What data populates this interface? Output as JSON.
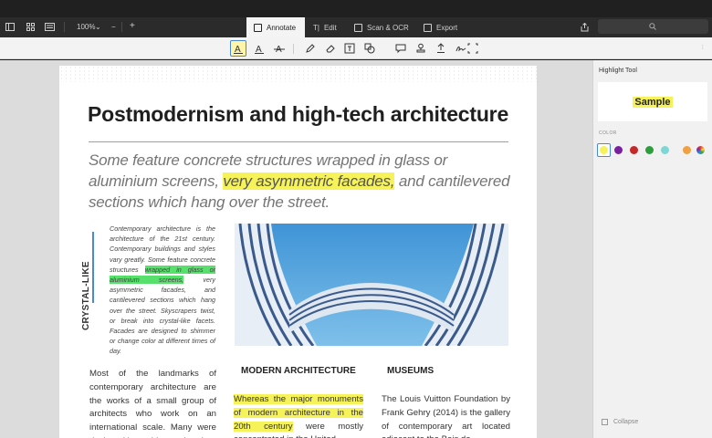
{
  "toolbar": {
    "zoom": "100%",
    "zoom_out": "−",
    "zoom_in": "+",
    "tabs": [
      {
        "label": "Annotate",
        "icon": "annotate-icon",
        "active": true
      },
      {
        "label": "Edit",
        "icon": "edit-text-icon",
        "active": false
      },
      {
        "label": "Scan & OCR",
        "icon": "scan-icon",
        "active": false
      },
      {
        "label": "Export",
        "icon": "export-icon",
        "active": false
      }
    ]
  },
  "annotate_tools": [
    "highlight-text-icon",
    "underline-text-icon",
    "strikethrough-text-icon",
    "pen-icon",
    "eraser-icon",
    "text-box-icon",
    "shapes-icon",
    "comment-icon",
    "stamp-icon",
    "upload-icon",
    "signature-icon",
    "crop-icon"
  ],
  "document": {
    "title": "Postmodernism  and high-tech architecture",
    "subtitle_pre": "Some feature concrete structures wrapped in glass  or aluminium screens, ",
    "subtitle_hl": "very asymmetric facades,",
    "subtitle_post": " and cantilevered sections which hang over the street.",
    "side_label": "CRYSTAL-LIKE",
    "side_pre": "Contemporary architecture is the architecture of the 21st century. Contemporary buildings and styles vary greatly. Some feature concrete structures ",
    "side_hl": "wrapped in glass or aluminium screens,",
    "side_post": " very asymmetric facades, and cantilevered sections which hang over the street. Skyscrapers twist, or break into crystal-like facets. Facades are designed to shimmer or change color at different times of day.",
    "col1_text": "Most of the landmarks of contemporary architecture are the works of a small group of architects who work on an international scale. Many were designed by architects already",
    "col2_heading": "MODERN ARCHITECTURE",
    "col2_hl": "Whereas the major monuments of modern architecture in the 20th century",
    "col2_post": " were mostly concentrated in the United",
    "col3_heading": "MUSEUMS",
    "col3_text": "The Louis Vuitton Foundation by Frank Gehry (2014) is the gallery of contemporary art located adjacent to the Bois de"
  },
  "panel": {
    "title": "Highlight Tool",
    "sample": "Sample",
    "color_label": "COLOR",
    "swatches": [
      "#f6f25a",
      "#7b1fa2",
      "#c62828",
      "#2e9e3c",
      "#7fd6d6",
      "#f0a040",
      "multicolor"
    ],
    "collapse": "Collapse"
  },
  "colors": {
    "highlight": "#f6f25a",
    "accent": "#4a8bd0",
    "dark_chrome": "#2b2b2b"
  }
}
